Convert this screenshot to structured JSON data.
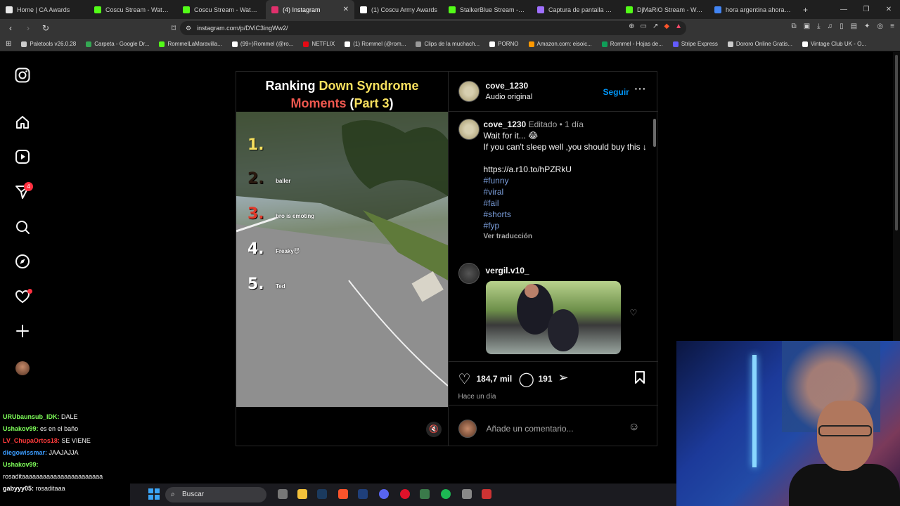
{
  "tabs": [
    {
      "title": "Home | CA Awards",
      "color": "#e8e8e8"
    },
    {
      "title": "Coscu Stream - Watch Live",
      "color": "#53fc18"
    },
    {
      "title": "Coscu Stream - Watch Live",
      "color": "#53fc18"
    },
    {
      "title": "(4) Instagram",
      "color": "#e1306c",
      "active": true
    },
    {
      "title": "(1) Coscu Army Awards",
      "color": "#ffffff"
    },
    {
      "title": "StalkerBlue Stream - Watch",
      "color": "#53fc18"
    },
    {
      "title": "Captura de pantalla por Li",
      "color": "#a070ff"
    },
    {
      "title": "DjMaRiO Stream - Watch",
      "color": "#53fc18"
    },
    {
      "title": "hora argentina ahora - Go",
      "color": "#4285f4"
    }
  ],
  "address": {
    "url": "instagram.com/p/DViC3ingWw2/"
  },
  "bookmarks": [
    {
      "label": "Paletools v26.0.28",
      "color": "#cccccc"
    },
    {
      "label": "Carpeta - Google Dr...",
      "color": "#34a853"
    },
    {
      "label": "RommelLaMaravilla...",
      "color": "#53fc18"
    },
    {
      "label": "(99+)Rommel (@ro...",
      "color": "#ffffff"
    },
    {
      "label": "NETFLIX",
      "color": "#e50914"
    },
    {
      "label": "(1) Rommel (@rom...",
      "color": "#ffffff"
    },
    {
      "label": "Clips de la muchach...",
      "color": "#999999"
    },
    {
      "label": "PORNO",
      "color": "#ffffff"
    },
    {
      "label": "Amazon.com: eisoic...",
      "color": "#ff9900"
    },
    {
      "label": "Rommel - Hojas de...",
      "color": "#0f9d58"
    },
    {
      "label": "Stripe Express",
      "color": "#635bff"
    },
    {
      "label": "Dororo Online Gratis...",
      "color": "#cccccc"
    },
    {
      "label": "Vintage Club UK - O...",
      "color": "#ffffff"
    }
  ],
  "nav": {
    "notif_count": "4"
  },
  "post": {
    "title_line1_a": "Ranking ",
    "title_line1_b": "Down Syndrome",
    "title_line2_a": "Moments",
    "title_line2_b": " (",
    "title_line2_c": "Part 3",
    "title_line2_d": ")",
    "ranks": [
      {
        "num": "1.",
        "label": "",
        "color": "#f7e05e"
      },
      {
        "num": "2.",
        "label": "baller",
        "color": "#2a1a10"
      },
      {
        "num": "3.",
        "label": "bro is emoting",
        "color": "#e23a2a"
      },
      {
        "num": "4.",
        "label": "Freaky😈",
        "color": "#ffffff"
      },
      {
        "num": "5.",
        "label": "Ted",
        "color": "#ffffff"
      }
    ],
    "author": "cove_1230",
    "audio": "Audio original",
    "follow": "Seguir",
    "caption_user": "cove_1230",
    "caption_edited": "Editado",
    "caption_time": "1 día",
    "caption_lines": [
      "Wait for it... 😂",
      "If you can't sleep well ,you should buy this ↓"
    ],
    "link": "https://a.r10.to/hPZRkU",
    "hashtags": [
      "#funny",
      "#viral",
      "#fail",
      "#shorts",
      "#fyp"
    ],
    "see_translation": "Ver traducción",
    "comment_user": "vergil.v10_",
    "likes": "184,7 mil",
    "comments": "191",
    "posted": "Hace un día",
    "add_comment": "Añade un comentario..."
  },
  "chat": [
    {
      "user": "URUbaunsub_IDK:",
      "msg": "DALE",
      "color": "#7fff5a"
    },
    {
      "user": "Ushakov99:",
      "msg": "es en el baño",
      "color": "#7fff5a"
    },
    {
      "user": "LV_ChupaOrtos18:",
      "msg": "SE VIENE",
      "color": "#ff3b3b"
    },
    {
      "user": "diegowissmar:",
      "msg": "JAAJAJJA",
      "color": "#3b9cff"
    },
    {
      "user": "Ushakov99:",
      "msg": "rosaditaaaaaaaaaaaaaaaaaaaaaaa",
      "color": "#7fff5a"
    },
    {
      "user": "gabyyy05:",
      "msg": "rosaditaaa",
      "color": "#ffffff"
    }
  ],
  "taskbar": {
    "search": "Buscar"
  }
}
